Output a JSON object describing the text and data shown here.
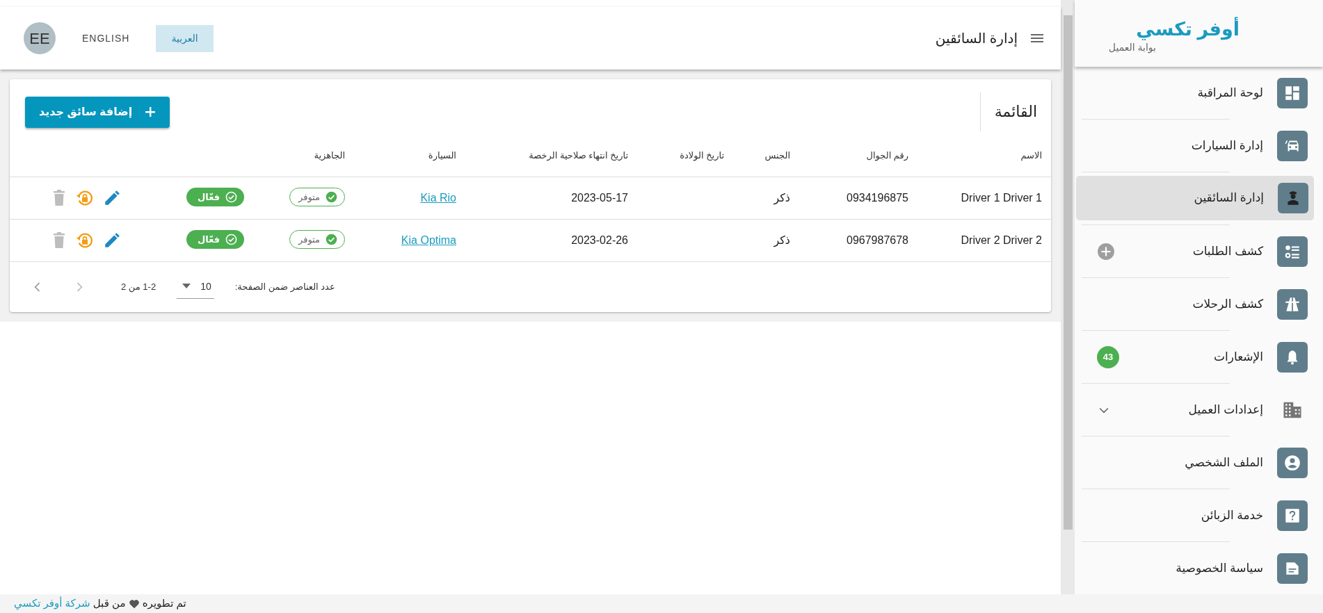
{
  "brand": {
    "title": "أوفر تكسي",
    "subtitle": "بوابة العميل"
  },
  "sidebar": {
    "items": [
      {
        "label": "لوحة المراقبة",
        "kind": "plain",
        "selected": false
      },
      {
        "label": "إدارة السيارات",
        "kind": "plain",
        "selected": false
      },
      {
        "label": "إدارة السائقين",
        "kind": "plain",
        "selected": true
      },
      {
        "label": "كشف الطلبات",
        "kind": "add",
        "selected": false
      },
      {
        "label": "كشف الرحلات",
        "kind": "plain",
        "selected": false
      },
      {
        "label": "الإشعارات",
        "kind": "badge",
        "badge": "43",
        "selected": false
      },
      {
        "label": "إعدادات العميل",
        "kind": "group",
        "expanded": false,
        "selected": false
      },
      {
        "label": "الملف الشخصي",
        "kind": "plain",
        "selected": false
      },
      {
        "label": "خدمة الزبائن",
        "kind": "plain",
        "selected": false
      },
      {
        "label": "سياسة الخصوصية",
        "kind": "plain",
        "selected": false
      }
    ]
  },
  "header": {
    "title": "إدارة السائقين",
    "languages": [
      {
        "label": "العربية",
        "selected": true
      },
      {
        "label": "ENGLISH",
        "selected": false
      }
    ],
    "avatar": "EE"
  },
  "card": {
    "title": "القائمة",
    "add_button": "إضافة سائق جديد",
    "table": {
      "columns": [
        "الاسم",
        "رقم الجوال",
        "الجنس",
        "تاريخ الولادة",
        "تاريخ انتهاء صلاحية الرخصة",
        "السيارة",
        "الجاهزية"
      ],
      "rows": [
        {
          "name": "Driver 1 Driver 1",
          "phone": "0934196875",
          "gender": "ذكر",
          "license_expiry": "2023-05-17",
          "car": "Kia Rio",
          "readiness": "متوفر",
          "status": "فعّال"
        },
        {
          "name": "Driver 2 Driver 2",
          "phone": "0967987678",
          "gender": "ذكر",
          "license_expiry": "2023-02-26",
          "car": "Kia Optima",
          "readiness": "متوفر",
          "status": "فعّال"
        }
      ]
    },
    "pagination": {
      "rows_per_page_label": "عدد العناصر ضمن الصفحة:",
      "rows_per_page": "10",
      "range": "1-2 من 2"
    }
  },
  "footer": {
    "before": "تم تطويره",
    "after": "من قبل",
    "link": "شركة أوفر تكسي"
  }
}
